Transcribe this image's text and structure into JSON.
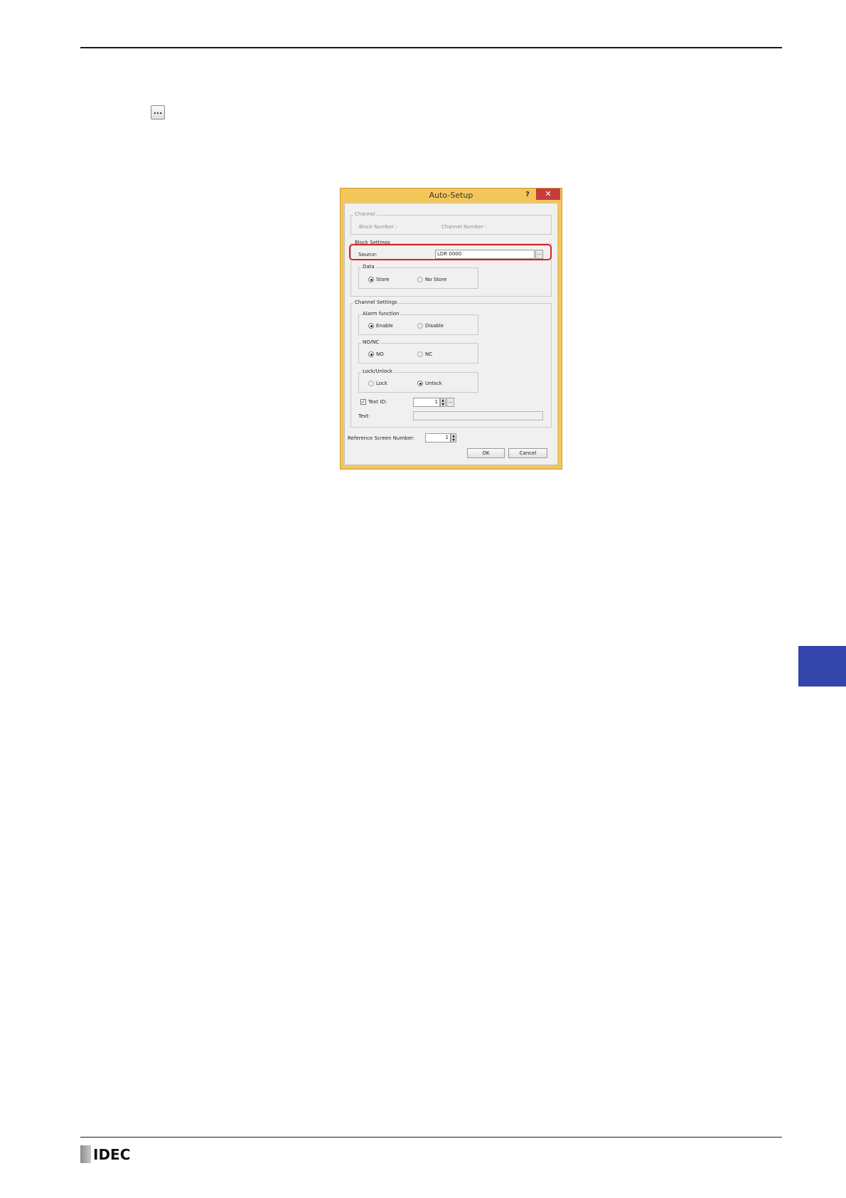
{
  "page": {
    "browse_button_label": "...",
    "logo_text": "IDEC"
  },
  "dialog": {
    "title": "Auto-Setup",
    "help_label": "?",
    "close_label": "✕",
    "channel_group": {
      "label": "Channel",
      "block_number_label": "Block Number :",
      "channel_number_label": "Channel Number :"
    },
    "block_settings": {
      "label": "Block Settings",
      "source_label": "Source:",
      "source_value": "LDR 0000",
      "browse_label": "...",
      "data_group": {
        "label": "Data",
        "store_label": "Store",
        "no_store_label": "No Store",
        "selected": "Store"
      }
    },
    "channel_settings": {
      "label": "Channel Settings",
      "alarm_function": {
        "label": "Alarm function",
        "enable_label": "Enable",
        "disable_label": "Disable",
        "selected": "Enable"
      },
      "no_nc": {
        "label": "NO/NC",
        "no_label": "NO",
        "nc_label": "NC",
        "selected": "NO"
      },
      "lock_unlock": {
        "label": "Lock/Unlock",
        "lock_label": "Lock",
        "unlock_label": "Unlock",
        "selected": "Unlock"
      },
      "text_id_label": "Text ID:",
      "text_id_checked": true,
      "text_id_value": "1",
      "text_id_browse": "...",
      "text_label": "Text:",
      "text_value": ""
    },
    "reference_screen_label": "Reference Screen Number:",
    "reference_screen_value": "1",
    "ok_label": "OK",
    "cancel_label": "Cancel"
  }
}
